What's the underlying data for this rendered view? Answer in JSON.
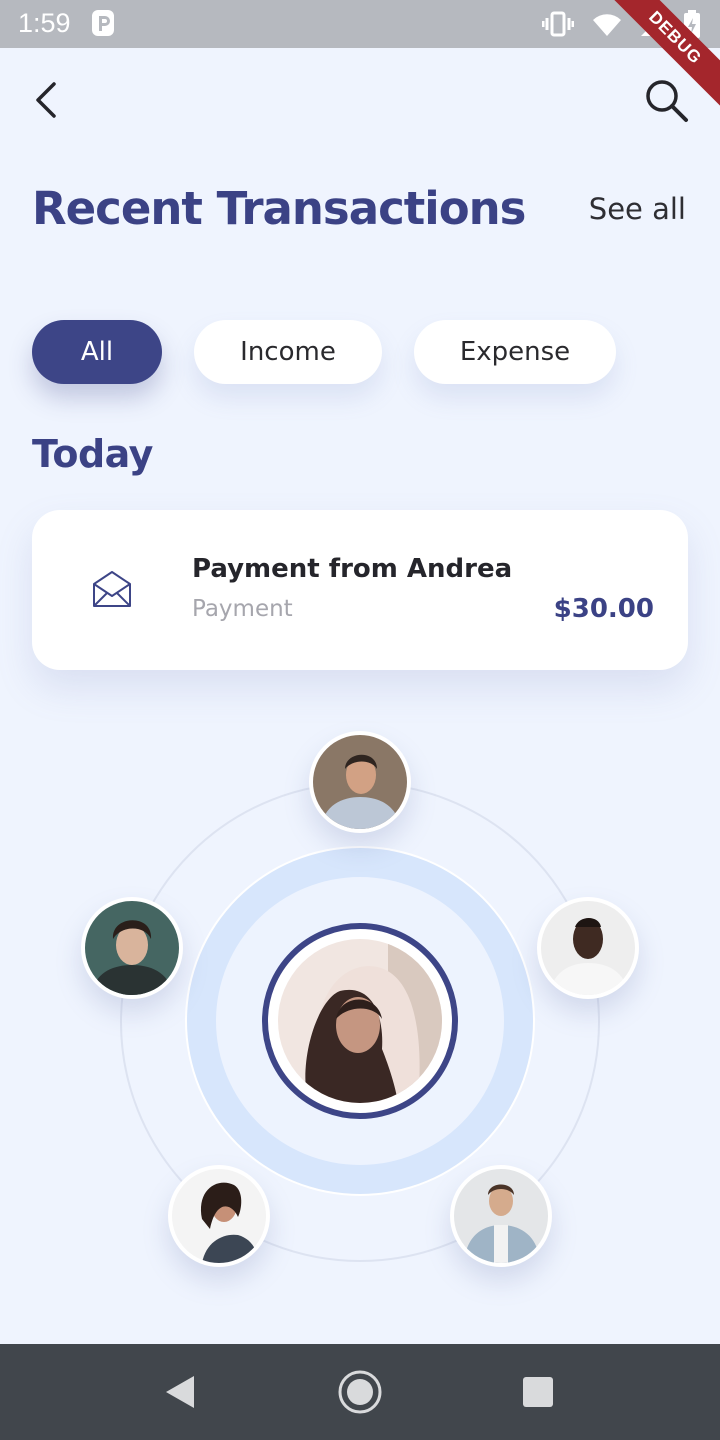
{
  "status_bar": {
    "time": "1:59",
    "icons": [
      "parking-icon",
      "vibrate-icon",
      "wifi-icon",
      "signal-icon",
      "battery-icon"
    ],
    "debug_label": "DEBUG"
  },
  "app_bar": {
    "back_icon": "chevron-left-icon",
    "search_icon": "search-icon"
  },
  "header": {
    "title": "Recent Transactions",
    "see_all": "See all"
  },
  "filters": {
    "selected": "All",
    "items": [
      "All",
      "Income",
      "Expense"
    ]
  },
  "section": {
    "title": "Today"
  },
  "transactions": [
    {
      "icon": "envelope-icon",
      "title": "Payment from Andrea",
      "subtitle": "Payment",
      "amount": "$30.00"
    }
  ],
  "contacts": {
    "center": "avatar-center",
    "orbit": [
      "avatar-top",
      "avatar-left",
      "avatar-right",
      "avatar-bottom-left",
      "avatar-bottom-right"
    ]
  },
  "colors": {
    "brand": "#3d4587",
    "background": "#eff4fe",
    "card": "#ffffff",
    "muted_text": "#a6a6ad",
    "ring": "#d7e6fc"
  },
  "nav_bar": {
    "icons": [
      "back-triangle-icon",
      "home-circle-icon",
      "recents-square-icon"
    ]
  }
}
